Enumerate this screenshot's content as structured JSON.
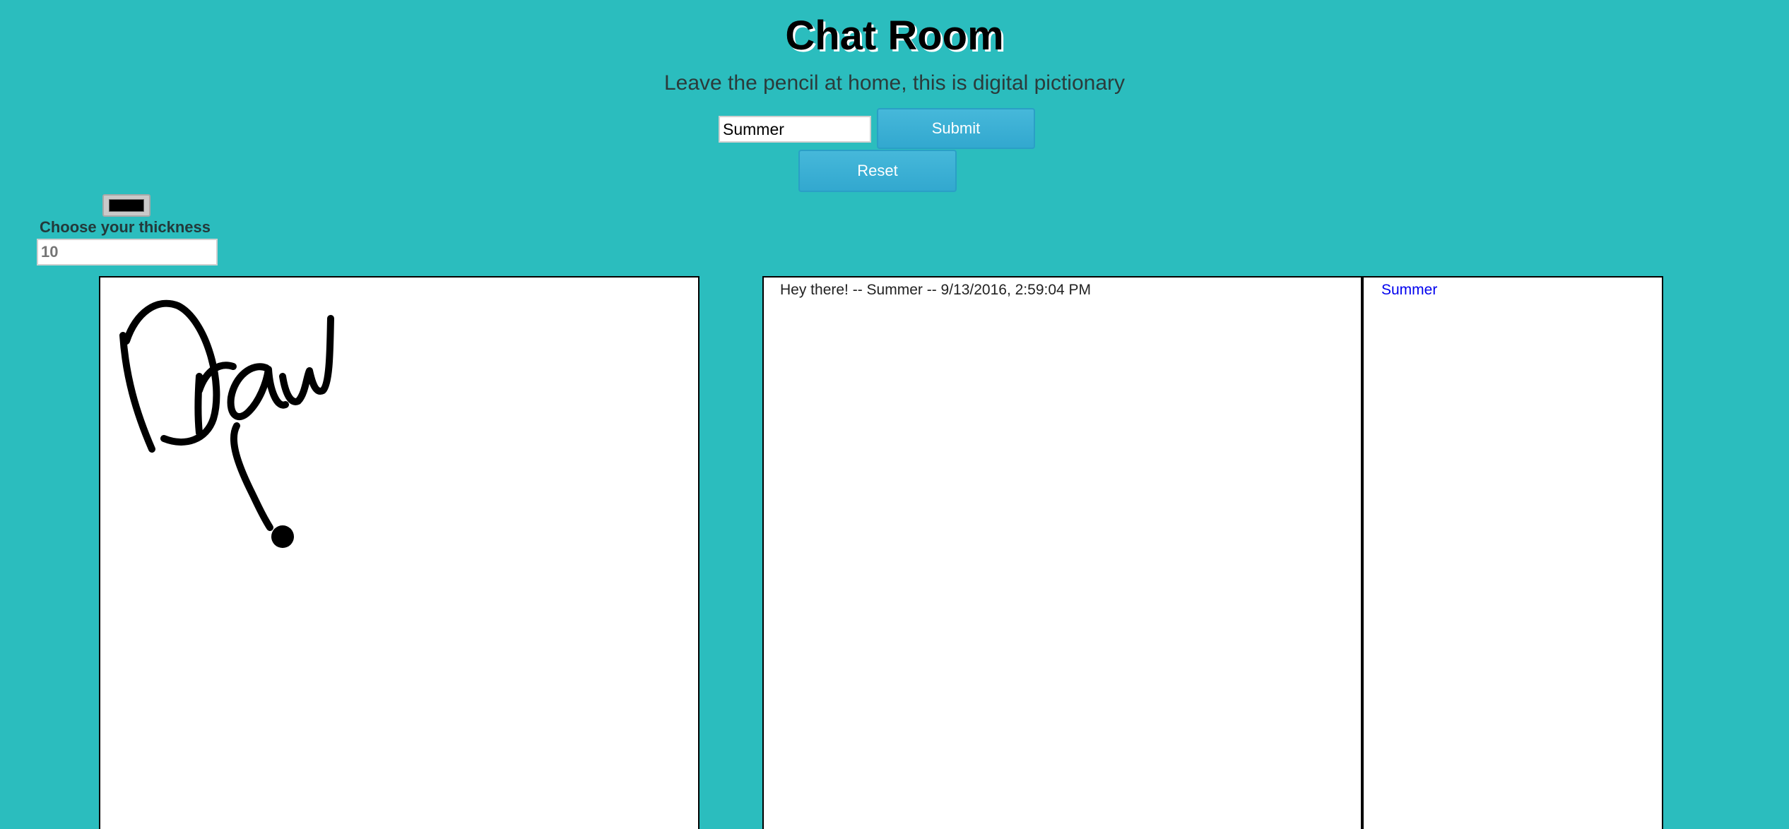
{
  "header": {
    "title": "Chat Room",
    "subtitle": "Leave the pencil at home, this is digital pictionary"
  },
  "form": {
    "name_value": "Summer",
    "submit_label": "Submit",
    "reset_label": "Reset"
  },
  "tools": {
    "current_color": "#000000",
    "thickness_label": "Choose your thickness",
    "thickness_placeholder": "10"
  },
  "messages": [
    {
      "text": "Hey there! -- Summer -- 9/13/2016, 2:59:04 PM"
    }
  ],
  "users": [
    {
      "name": "Summer"
    }
  ],
  "theme": {
    "background": "#2bbdbe",
    "button": "#46b8da",
    "user_link": "#0000ee"
  }
}
